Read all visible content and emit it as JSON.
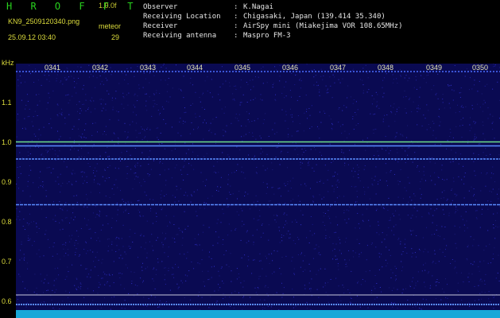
{
  "header": {
    "title": "H R O F F T",
    "version": "1.0.0f",
    "filename": "KN9_2509120340.png",
    "meteor_label": "meteor",
    "datetime": "25.09.12 03:40",
    "count": "29"
  },
  "info": [
    {
      "key": "Observer",
      "value": "K.Nagai"
    },
    {
      "key": "Receiving Location",
      "value": "Chigasaki, Japan (139.414 35.340)"
    },
    {
      "key": "Receiver",
      "value": "AirSpy mini (Miakejima VOR 108.65MHz)"
    },
    {
      "key": "Receiving antenna",
      "value": "Maspro FM-3"
    }
  ],
  "axis": {
    "unit": "kHz",
    "ticks": [
      {
        "label": "1.1",
        "value": 1.1
      },
      {
        "label": "1.0",
        "value": 1.0
      },
      {
        "label": "0.9",
        "value": 0.9
      },
      {
        "label": "0.8",
        "value": 0.8
      },
      {
        "label": "0.7",
        "value": 0.7
      },
      {
        "label": "0.6",
        "value": 0.6
      }
    ]
  },
  "time_labels": [
    "0341",
    "0342",
    "0343",
    "0344",
    "0345",
    "0346",
    "0347",
    "0348",
    "0349",
    "0350"
  ],
  "colors": {
    "background": "#0a0a52",
    "title": "#28d21e",
    "label": "#dcdc3c",
    "line_green": "#6ee08c",
    "line_blue": "#5a8cff",
    "line_white": "#c8c8dc",
    "bottom_band": "#18a8d8"
  }
}
